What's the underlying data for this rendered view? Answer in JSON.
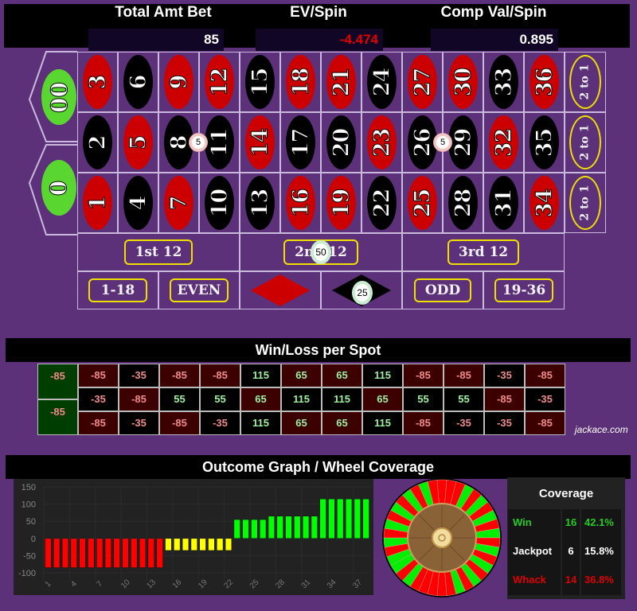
{
  "header": {
    "total_label": "Total Amt Bet",
    "total_value": "85",
    "ev_label": "EV/Spin",
    "ev_value": "-4.474",
    "comp_label": "Comp Val/Spin",
    "comp_value": "0.895"
  },
  "board": {
    "zeros": [
      "00",
      "0"
    ],
    "rows": [
      [
        {
          "n": "3",
          "c": "red"
        },
        {
          "n": "6",
          "c": "black"
        },
        {
          "n": "9",
          "c": "red"
        },
        {
          "n": "12",
          "c": "red"
        },
        {
          "n": "15",
          "c": "black"
        },
        {
          "n": "18",
          "c": "red"
        },
        {
          "n": "21",
          "c": "red"
        },
        {
          "n": "24",
          "c": "black"
        },
        {
          "n": "27",
          "c": "red"
        },
        {
          "n": "30",
          "c": "red"
        },
        {
          "n": "33",
          "c": "black"
        },
        {
          "n": "36",
          "c": "red"
        }
      ],
      [
        {
          "n": "2",
          "c": "black"
        },
        {
          "n": "5",
          "c": "red"
        },
        {
          "n": "8",
          "c": "black"
        },
        {
          "n": "11",
          "c": "black"
        },
        {
          "n": "14",
          "c": "red"
        },
        {
          "n": "17",
          "c": "black"
        },
        {
          "n": "20",
          "c": "black"
        },
        {
          "n": "23",
          "c": "red"
        },
        {
          "n": "26",
          "c": "black"
        },
        {
          "n": "29",
          "c": "black"
        },
        {
          "n": "32",
          "c": "red"
        },
        {
          "n": "35",
          "c": "black"
        }
      ],
      [
        {
          "n": "1",
          "c": "red"
        },
        {
          "n": "4",
          "c": "black"
        },
        {
          "n": "7",
          "c": "red"
        },
        {
          "n": "10",
          "c": "black"
        },
        {
          "n": "13",
          "c": "black"
        },
        {
          "n": "16",
          "c": "red"
        },
        {
          "n": "19",
          "c": "red"
        },
        {
          "n": "22",
          "c": "black"
        },
        {
          "n": "25",
          "c": "red"
        },
        {
          "n": "28",
          "c": "black"
        },
        {
          "n": "31",
          "c": "black"
        },
        {
          "n": "34",
          "c": "red"
        }
      ]
    ],
    "column_bets": [
      "2 to 1",
      "2 to 1",
      "2 to 1"
    ],
    "dozens": [
      "1st 12",
      "2nd 12",
      "3rd 12"
    ],
    "outside": [
      "1-18",
      "EVEN",
      "ODD",
      "19-36"
    ],
    "chips": {
      "split_8_11": "5",
      "split_26_29": "5",
      "second_dozen": "50",
      "black": "25"
    }
  },
  "winloss": {
    "title": "Win/Loss per Spot",
    "zeros": [
      "-85",
      "-85"
    ],
    "rows": [
      [
        "-85",
        "-35",
        "-85",
        "-85",
        "115",
        "65",
        "65",
        "115",
        "-85",
        "-85",
        "-35",
        "-85"
      ],
      [
        "-35",
        "-85",
        "55",
        "55",
        "65",
        "115",
        "115",
        "65",
        "55",
        "55",
        "-85",
        "-35"
      ],
      [
        "-85",
        "-35",
        "-85",
        "-35",
        "115",
        "65",
        "65",
        "115",
        "-85",
        "-35",
        "-35",
        "-85"
      ]
    ],
    "watermark": "jackace.com"
  },
  "outcome": {
    "title": "Outcome Graph / Wheel Coverage"
  },
  "chart_data": {
    "type": "bar",
    "title": "",
    "xlabel": "",
    "ylabel": "",
    "ylim": [
      -100,
      150
    ],
    "yticks": [
      150,
      100,
      50,
      0,
      -50,
      -100
    ],
    "xticks": [
      "1",
      "4",
      "7",
      "10",
      "13",
      "16",
      "19",
      "22",
      "25",
      "28",
      "31",
      "34",
      "37"
    ],
    "values": [
      -85,
      -85,
      -85,
      -85,
      -85,
      -85,
      -85,
      -85,
      -85,
      -85,
      -85,
      -85,
      -85,
      -85,
      -35,
      -35,
      -35,
      -35,
      -35,
      -35,
      -35,
      -35,
      55,
      55,
      55,
      55,
      65,
      65,
      65,
      65,
      65,
      65,
      115,
      115,
      115,
      115,
      115,
      115
    ],
    "colors": {
      "loss": "#ff0000",
      "jackpot": "#ffff00",
      "win": "#00ff00"
    }
  },
  "coverage": {
    "title": "Coverage",
    "rows": [
      {
        "label": "Win",
        "count": "16",
        "pct": "42.1%",
        "color": "#22cc22"
      },
      {
        "label": "Jackpot",
        "count": "6",
        "pct": "15.8%",
        "color": "#ffffff"
      },
      {
        "label": "Whack",
        "count": "14",
        "pct": "36.8%",
        "color": "#dd0000"
      }
    ]
  }
}
